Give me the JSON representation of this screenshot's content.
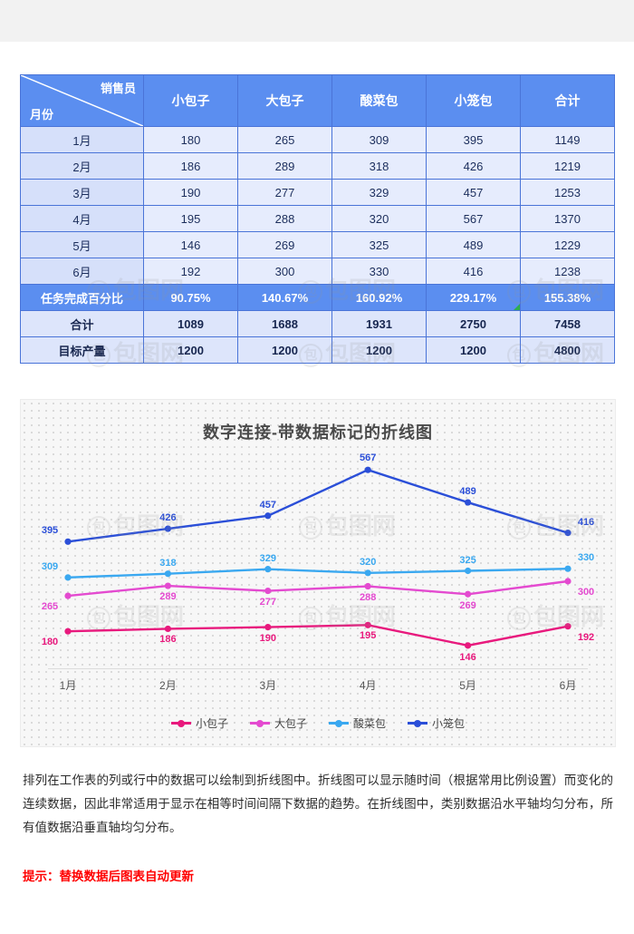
{
  "table": {
    "corner_top_right": "销售员",
    "corner_bottom_left": "月份",
    "columns": [
      "小包子",
      "大包子",
      "酸菜包",
      "小笼包",
      "合计"
    ],
    "rows": [
      {
        "label": "1月",
        "values": [
          "180",
          "265",
          "309",
          "395",
          "1149"
        ]
      },
      {
        "label": "2月",
        "values": [
          "186",
          "289",
          "318",
          "426",
          "1219"
        ]
      },
      {
        "label": "3月",
        "values": [
          "190",
          "277",
          "329",
          "457",
          "1253"
        ]
      },
      {
        "label": "4月",
        "values": [
          "195",
          "288",
          "320",
          "567",
          "1370"
        ]
      },
      {
        "label": "5月",
        "values": [
          "146",
          "269",
          "325",
          "489",
          "1229"
        ]
      },
      {
        "label": "6月",
        "values": [
          "192",
          "300",
          "330",
          "416",
          "1238"
        ]
      }
    ],
    "percent_row": {
      "label": "任务完成百分比",
      "values": [
        "90.75%",
        "140.67%",
        "160.92%",
        "229.17%",
        "155.38%"
      ]
    },
    "total_row": {
      "label": "合计",
      "values": [
        "1089",
        "1688",
        "1931",
        "2750",
        "7458"
      ]
    },
    "target_row": {
      "label": "目标产量",
      "values": [
        "1200",
        "1200",
        "1200",
        "1200",
        "4800"
      ]
    }
  },
  "chart_data": {
    "type": "line",
    "title": "数字连接-带数据标记的折线图",
    "xlabel": "",
    "ylabel": "",
    "categories": [
      "1月",
      "2月",
      "3月",
      "4月",
      "5月",
      "6月"
    ],
    "ylim": [
      100,
      600
    ],
    "grid": false,
    "legend_position": "bottom",
    "series": [
      {
        "name": "小包子",
        "color": "#e8197d",
        "values": [
          180,
          186,
          190,
          195,
          146,
          192
        ]
      },
      {
        "name": "大包子",
        "color": "#e44ad0",
        "values": [
          265,
          289,
          277,
          288,
          269,
          300
        ]
      },
      {
        "name": "酸菜包",
        "color": "#3aa8f0",
        "values": [
          309,
          318,
          329,
          320,
          325,
          330
        ]
      },
      {
        "name": "小笼包",
        "color": "#2b4fd8",
        "values": [
          395,
          426,
          457,
          567,
          489,
          416
        ]
      }
    ]
  },
  "description": "排列在工作表的列或行中的数据可以绘制到折线图中。折线图可以显示随时间（根据常用比例设置）而变化的连续数据，因此非常适用于显示在相等时间间隔下数据的趋势。在折线图中，类别数据沿水平轴均匀分布，所有值数据沿垂直轴均匀分布。",
  "tip": "提示：替换数据后图表自动更新",
  "watermark": "包图网"
}
